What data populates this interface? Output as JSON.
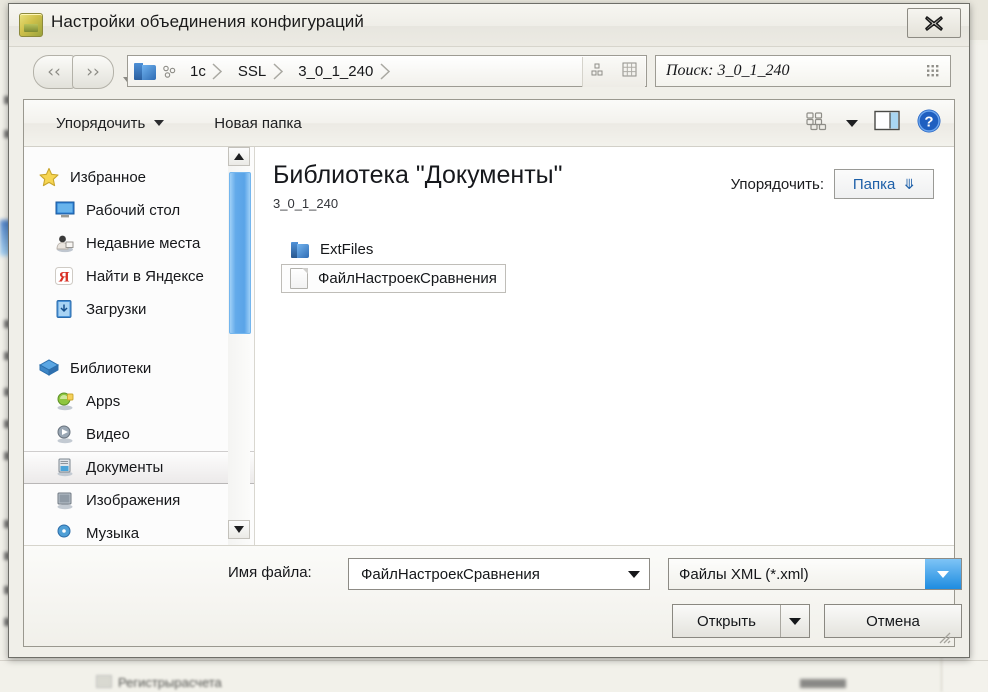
{
  "window": {
    "title": "Настройки объединения конфигураций",
    "app_icon": "app-icon",
    "close_label": "✕"
  },
  "address_bar": {
    "back_icon": "back-chevron-icon",
    "forward_icon": "forward-chevron-icon",
    "history_dropdown_icon": "chevron-down-icon",
    "folder_icon": "folder-icon",
    "share_icon": "share-nodes-icon",
    "crumbs": [
      "1c",
      "SSL",
      "3_0_1_240"
    ],
    "tool1_icon": "sort-icon",
    "tool2_icon": "grid-icon"
  },
  "search": {
    "value": "Поиск: 3_0_1_240",
    "placeholder": "Поиск: 3_0_1_240",
    "grip_icon": "search-grip-icon"
  },
  "command_bar": {
    "organize_label": "Упорядочить",
    "organize_caret_icon": "caret-down-icon",
    "new_folder_label": "Новая папка",
    "view_icon": "view-mode-icon",
    "view_caret_icon": "caret-down-icon",
    "preview_pane_icon": "preview-pane-icon",
    "help_icon": "help-icon"
  },
  "nav_pane": {
    "groups": [
      {
        "root": {
          "label": "Избранное",
          "icon": "star-icon"
        },
        "items": [
          {
            "label": "Рабочий стол",
            "icon": "desktop-icon"
          },
          {
            "label": "Недавние места",
            "icon": "recent-places-icon"
          },
          {
            "label": "Найти в Яндексе",
            "icon": "yandex-icon"
          },
          {
            "label": "Загрузки",
            "icon": "downloads-icon"
          }
        ]
      },
      {
        "root": {
          "label": "Библиотеки",
          "icon": "libraries-icon"
        },
        "items": [
          {
            "label": "Apps",
            "icon": "apps-library-icon",
            "selected": false
          },
          {
            "label": "Видео",
            "icon": "video-library-icon",
            "selected": false
          },
          {
            "label": "Документы",
            "icon": "documents-library-icon",
            "selected": true
          },
          {
            "label": "Изображения",
            "icon": "pictures-library-icon",
            "selected": false
          },
          {
            "label": "Музыка",
            "icon": "music-library-icon",
            "selected": false
          }
        ]
      }
    ],
    "scrollbar": {
      "up_icon": "scroll-up-arrow-icon",
      "down_icon": "scroll-down-arrow-icon"
    }
  },
  "content": {
    "library_title": "Библиотека \"Документы\"",
    "library_subtitle": "3_0_1_240",
    "arrange_label": "Упорядочить:",
    "arrange_value": "Папка",
    "arrange_caret_icon": "double-chevron-down-icon",
    "files": [
      {
        "name": "ExtFiles",
        "icon": "folder-icon",
        "selected": false
      },
      {
        "name": "ФайлНастроекСравнения",
        "icon": "document-icon",
        "selected": true
      }
    ]
  },
  "form": {
    "file_name_label": "Имя файла:",
    "file_name_value": "ФайлНастроекСравнения",
    "file_name_caret_icon": "caret-down-icon",
    "file_type_value": "Файлы XML (*.xml)",
    "file_type_caret_icon": "caret-down-icon",
    "open_label": "Открыть",
    "open_split_icon": "caret-down-icon",
    "cancel_label": "Отмена",
    "resize_grip_icon": "resize-grip-icon"
  },
  "background": {
    "bottom_text": "Регистрырасчета",
    "blurred_menu": [
      "",
      "",
      "",
      ""
    ]
  },
  "colors": {
    "accent_blue": "#1d5fa8",
    "scrollbar_blue": "#5aa4e8",
    "dropdown_blue": "#1e8ce0",
    "dialog_bg": "#f0efe9",
    "desktop_bg": "#e9e7dd"
  }
}
